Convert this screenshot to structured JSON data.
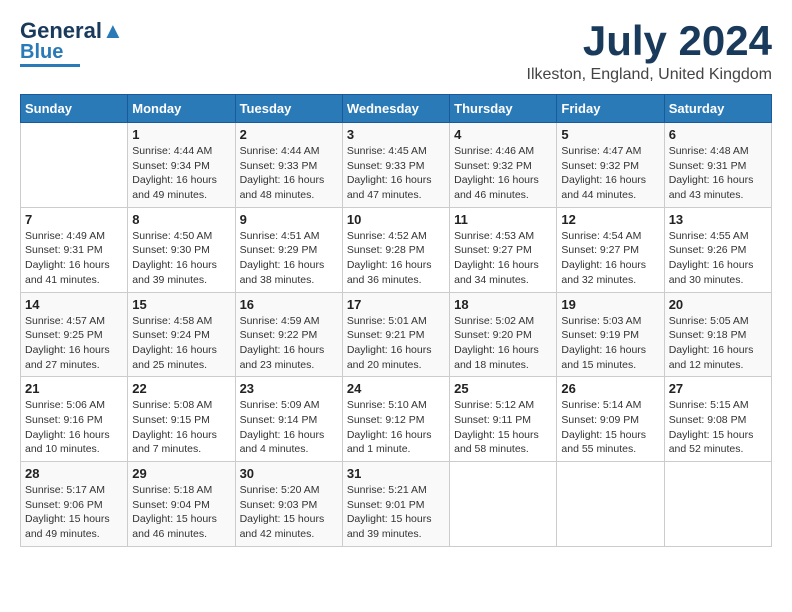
{
  "header": {
    "logo_line1": "General",
    "logo_line2": "Blue",
    "month": "July 2024",
    "location": "Ilkeston, England, United Kingdom"
  },
  "days_of_week": [
    "Sunday",
    "Monday",
    "Tuesday",
    "Wednesday",
    "Thursday",
    "Friday",
    "Saturday"
  ],
  "weeks": [
    [
      {
        "day": "",
        "info": ""
      },
      {
        "day": "1",
        "info": "Sunrise: 4:44 AM\nSunset: 9:34 PM\nDaylight: 16 hours and 49 minutes."
      },
      {
        "day": "2",
        "info": "Sunrise: 4:44 AM\nSunset: 9:33 PM\nDaylight: 16 hours and 48 minutes."
      },
      {
        "day": "3",
        "info": "Sunrise: 4:45 AM\nSunset: 9:33 PM\nDaylight: 16 hours and 47 minutes."
      },
      {
        "day": "4",
        "info": "Sunrise: 4:46 AM\nSunset: 9:32 PM\nDaylight: 16 hours and 46 minutes."
      },
      {
        "day": "5",
        "info": "Sunrise: 4:47 AM\nSunset: 9:32 PM\nDaylight: 16 hours and 44 minutes."
      },
      {
        "day": "6",
        "info": "Sunrise: 4:48 AM\nSunset: 9:31 PM\nDaylight: 16 hours and 43 minutes."
      }
    ],
    [
      {
        "day": "7",
        "info": "Sunrise: 4:49 AM\nSunset: 9:31 PM\nDaylight: 16 hours and 41 minutes."
      },
      {
        "day": "8",
        "info": "Sunrise: 4:50 AM\nSunset: 9:30 PM\nDaylight: 16 hours and 39 minutes."
      },
      {
        "day": "9",
        "info": "Sunrise: 4:51 AM\nSunset: 9:29 PM\nDaylight: 16 hours and 38 minutes."
      },
      {
        "day": "10",
        "info": "Sunrise: 4:52 AM\nSunset: 9:28 PM\nDaylight: 16 hours and 36 minutes."
      },
      {
        "day": "11",
        "info": "Sunrise: 4:53 AM\nSunset: 9:27 PM\nDaylight: 16 hours and 34 minutes."
      },
      {
        "day": "12",
        "info": "Sunrise: 4:54 AM\nSunset: 9:27 PM\nDaylight: 16 hours and 32 minutes."
      },
      {
        "day": "13",
        "info": "Sunrise: 4:55 AM\nSunset: 9:26 PM\nDaylight: 16 hours and 30 minutes."
      }
    ],
    [
      {
        "day": "14",
        "info": "Sunrise: 4:57 AM\nSunset: 9:25 PM\nDaylight: 16 hours and 27 minutes."
      },
      {
        "day": "15",
        "info": "Sunrise: 4:58 AM\nSunset: 9:24 PM\nDaylight: 16 hours and 25 minutes."
      },
      {
        "day": "16",
        "info": "Sunrise: 4:59 AM\nSunset: 9:22 PM\nDaylight: 16 hours and 23 minutes."
      },
      {
        "day": "17",
        "info": "Sunrise: 5:01 AM\nSunset: 9:21 PM\nDaylight: 16 hours and 20 minutes."
      },
      {
        "day": "18",
        "info": "Sunrise: 5:02 AM\nSunset: 9:20 PM\nDaylight: 16 hours and 18 minutes."
      },
      {
        "day": "19",
        "info": "Sunrise: 5:03 AM\nSunset: 9:19 PM\nDaylight: 16 hours and 15 minutes."
      },
      {
        "day": "20",
        "info": "Sunrise: 5:05 AM\nSunset: 9:18 PM\nDaylight: 16 hours and 12 minutes."
      }
    ],
    [
      {
        "day": "21",
        "info": "Sunrise: 5:06 AM\nSunset: 9:16 PM\nDaylight: 16 hours and 10 minutes."
      },
      {
        "day": "22",
        "info": "Sunrise: 5:08 AM\nSunset: 9:15 PM\nDaylight: 16 hours and 7 minutes."
      },
      {
        "day": "23",
        "info": "Sunrise: 5:09 AM\nSunset: 9:14 PM\nDaylight: 16 hours and 4 minutes."
      },
      {
        "day": "24",
        "info": "Sunrise: 5:10 AM\nSunset: 9:12 PM\nDaylight: 16 hours and 1 minute."
      },
      {
        "day": "25",
        "info": "Sunrise: 5:12 AM\nSunset: 9:11 PM\nDaylight: 15 hours and 58 minutes."
      },
      {
        "day": "26",
        "info": "Sunrise: 5:14 AM\nSunset: 9:09 PM\nDaylight: 15 hours and 55 minutes."
      },
      {
        "day": "27",
        "info": "Sunrise: 5:15 AM\nSunset: 9:08 PM\nDaylight: 15 hours and 52 minutes."
      }
    ],
    [
      {
        "day": "28",
        "info": "Sunrise: 5:17 AM\nSunset: 9:06 PM\nDaylight: 15 hours and 49 minutes."
      },
      {
        "day": "29",
        "info": "Sunrise: 5:18 AM\nSunset: 9:04 PM\nDaylight: 15 hours and 46 minutes."
      },
      {
        "day": "30",
        "info": "Sunrise: 5:20 AM\nSunset: 9:03 PM\nDaylight: 15 hours and 42 minutes."
      },
      {
        "day": "31",
        "info": "Sunrise: 5:21 AM\nSunset: 9:01 PM\nDaylight: 15 hours and 39 minutes."
      },
      {
        "day": "",
        "info": ""
      },
      {
        "day": "",
        "info": ""
      },
      {
        "day": "",
        "info": ""
      }
    ]
  ]
}
